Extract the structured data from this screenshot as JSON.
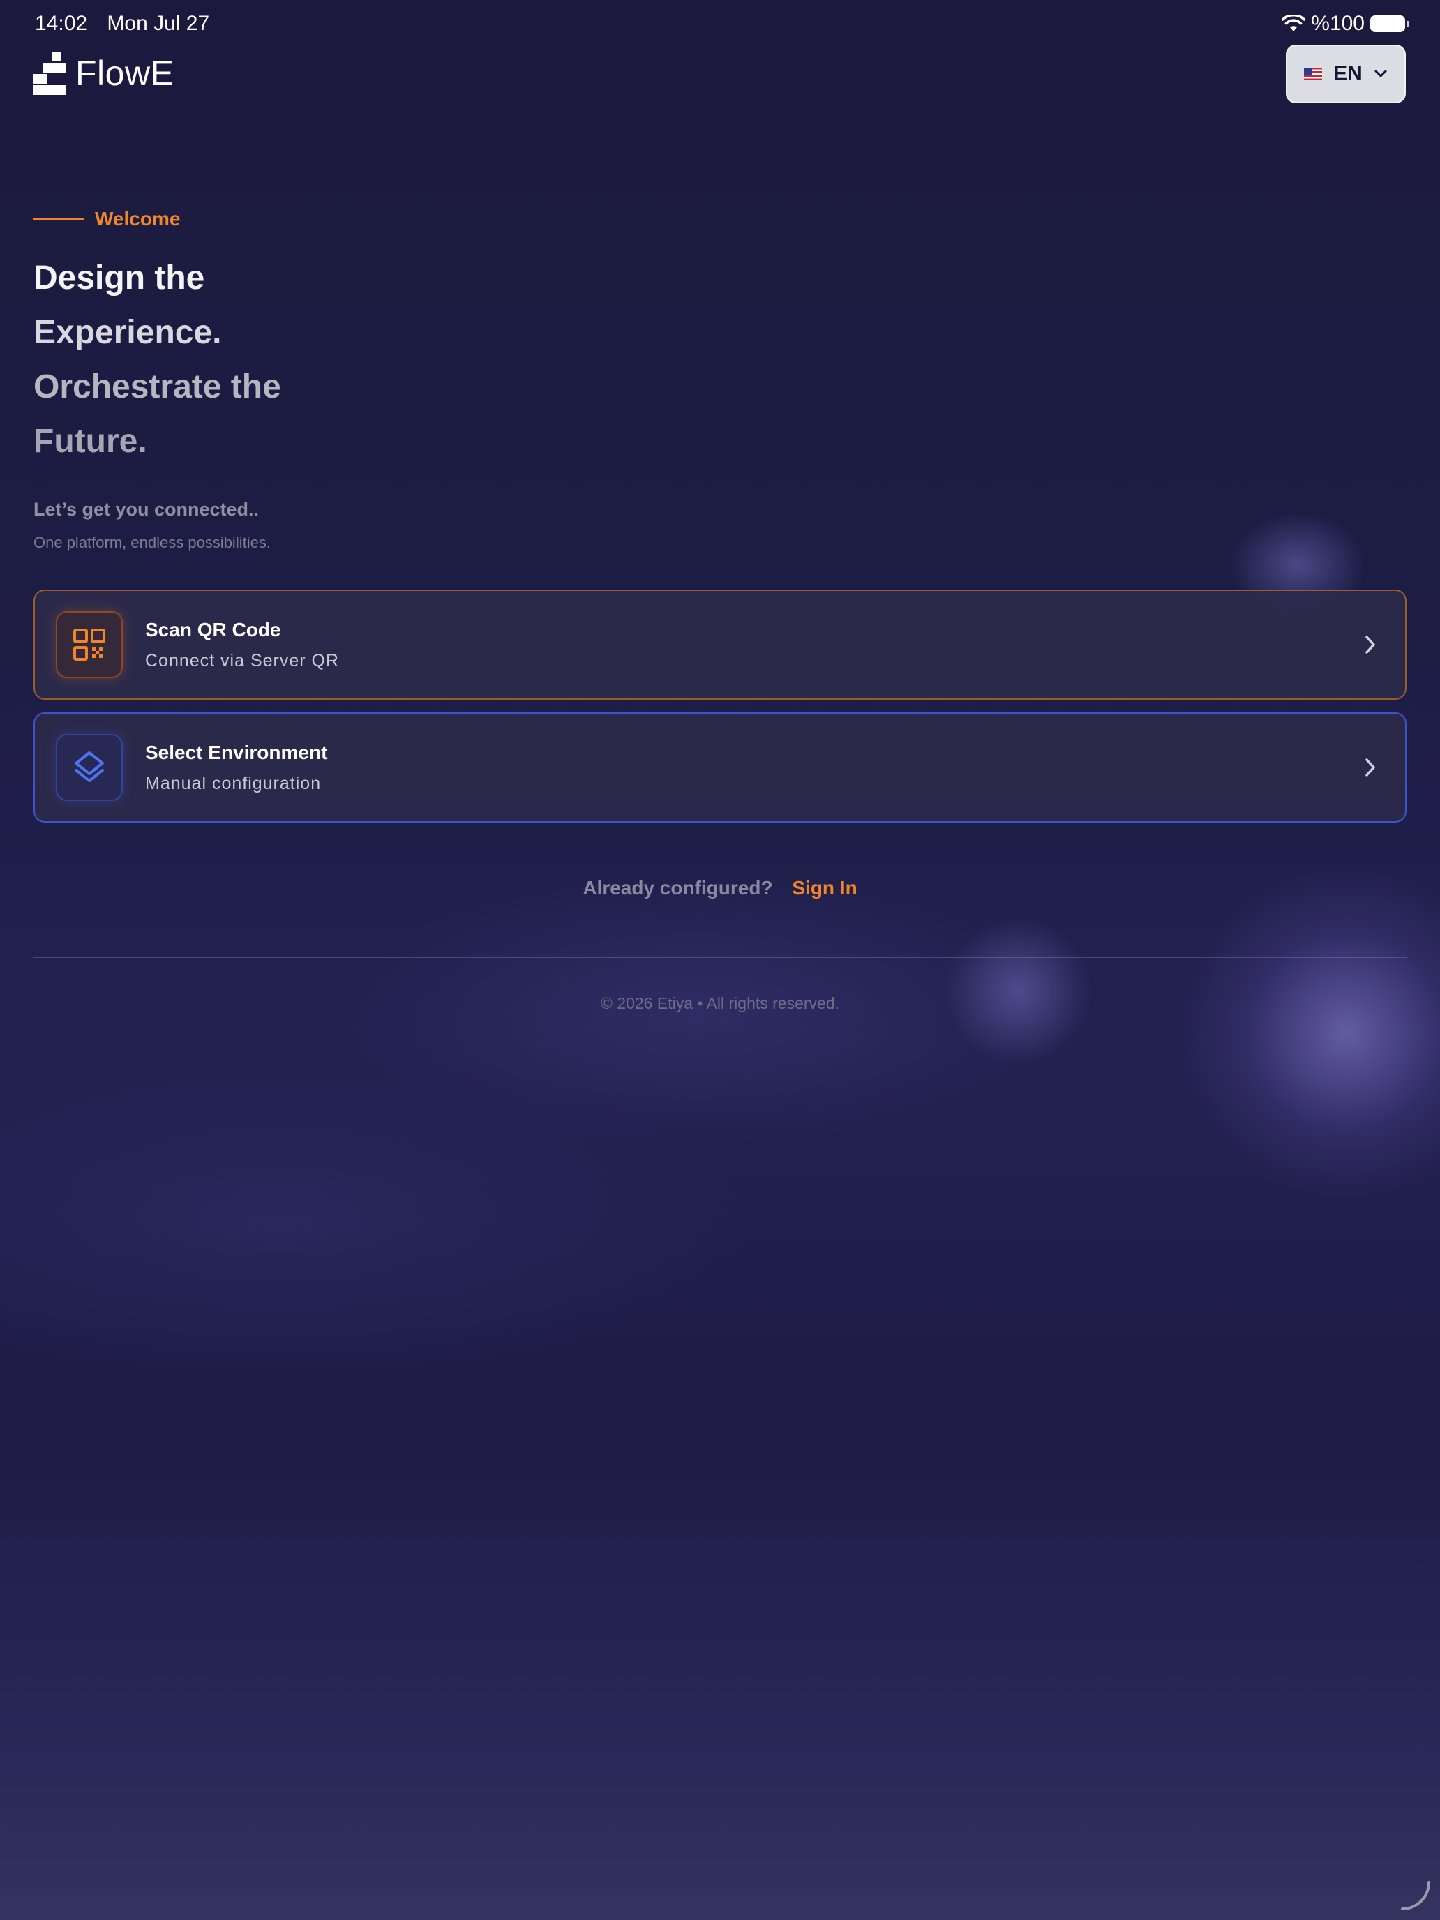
{
  "status_bar": {
    "time": "14:02",
    "date": "Mon Jul 27",
    "battery": "%100"
  },
  "header": {
    "app_name": "FlowE",
    "language": {
      "code": "EN",
      "flag": "us-flag-icon"
    }
  },
  "welcome": {
    "eyebrow": "Welcome",
    "headline": [
      "Design the",
      "Experience.",
      "Orchestrate the",
      "Future."
    ],
    "subtitle": "Let’s get you connected..",
    "tagline": "One platform, endless possibilities."
  },
  "options": [
    {
      "title": "Scan QR Code",
      "subtitle": "Connect via Server QR",
      "icon": "qr-code-icon"
    },
    {
      "title": "Select Environment",
      "subtitle": "Manual configuration",
      "icon": "layers-icon"
    }
  ],
  "signin": {
    "prompt": "Already configured?",
    "link": "Sign In"
  },
  "footer": {
    "copyright": "© 2026 Etiya • All rights reserved."
  },
  "colors": {
    "accent_orange": "#f0862a",
    "accent_blue": "#3c56c8",
    "background": "#1d1c44"
  }
}
